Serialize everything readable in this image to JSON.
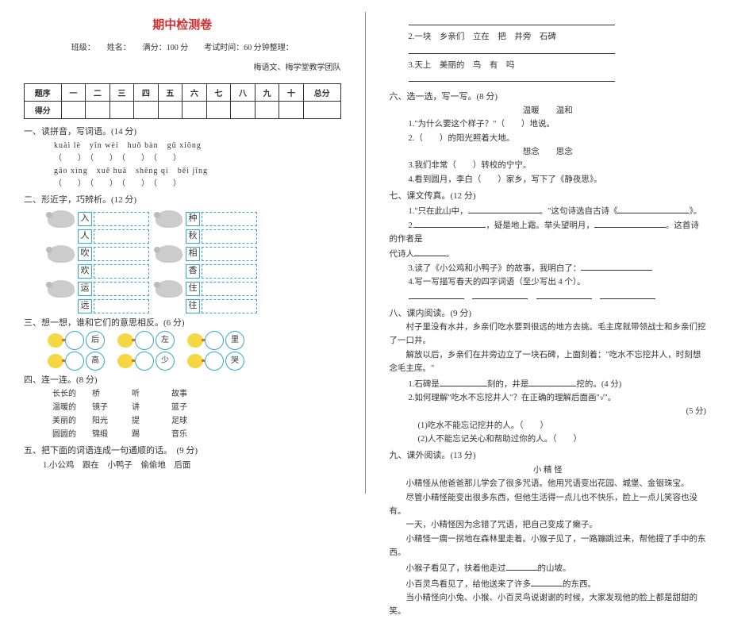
{
  "title": "期中检测卷",
  "header": "班级：　　姓名：　　满分：100 分　　考试时间：60 分钟整理：",
  "credit": "梅语文、梅学堂教学团队",
  "scoreTable": {
    "row1": [
      "题序",
      "一",
      "二",
      "三",
      "四",
      "五",
      "六",
      "七",
      "八",
      "九",
      "十",
      "总分"
    ],
    "row2Label": "得分"
  },
  "s1": {
    "title": "一、读拼音，写词语。(14 分)",
    "pinyin1": "kuài lè　yīn wèi　huǒ bàn　gǔ xiōng",
    "paren1": "（　　）　（　　）　（　　）　（　　）",
    "pinyin2": "gāo xìng　xuě huā　shēng qì　běi jīng",
    "paren2": "（　　）　（　　）　（　　）　（　　）"
  },
  "s2": {
    "title": "二、形近字，巧辨析。(12 分)",
    "pairs": [
      [
        "入",
        "种"
      ],
      [
        "人",
        "秋"
      ],
      [
        "吹",
        "相"
      ],
      [
        "欢",
        "香"
      ],
      [
        "运",
        "住"
      ],
      [
        "远",
        "往"
      ]
    ]
  },
  "s3": {
    "title": "三、想一想，谁和它们的意思相反。(6 分)",
    "row1": [
      "后",
      "左",
      "里"
    ],
    "row2": [
      "高",
      "少",
      "哭"
    ]
  },
  "s4": {
    "title": "四、连一连。(8 分)",
    "left": [
      "长长的",
      "温暖的",
      "美丽的",
      "圆圆的"
    ],
    "mid1": [
      "桥",
      "镜子",
      "阳光",
      "锦缎"
    ],
    "mid2": [
      "听",
      "讲",
      "提",
      "踢"
    ],
    "right": [
      "故事",
      "篮子",
      "足球",
      "音乐"
    ]
  },
  "s5": {
    "title": "五、把下面的词语连成一句通顺的话。　(9 分)",
    "item1": "1.小公鸡　跟在　小鸭子　偷偷地　后面",
    "item2": "2.一块　乡亲们　立在　把　井旁　石碑",
    "item3": "3.天上　美丽的　鸟　有　吗"
  },
  "s6": {
    "title": "六、选一选，写一写。(8 分)",
    "pair1": "温暖　　温和",
    "q1": "1.\"为什么要这个样子？\"（　　）地说。",
    "q2": "2.（　　）的阳光照着大地。",
    "pair2": "想念　　思念",
    "q3": "3.我们非常（　　）转校的宁宁。",
    "q4": "4.看到圆月，李白（　　）家乡，写下了《静夜思》。"
  },
  "s7": {
    "title": "七、课文传真。(12 分)",
    "q1a": "1.\"只在此山中，",
    "q1b": "。\"这句诗选自古诗《",
    "q1c": "》。",
    "q2a": "2.",
    "q2b": "，疑是地上霜。举头望明月，",
    "q2c": "。这首诗的作者是",
    "q2d": "代诗人",
    "q2e": "。",
    "q3": "3.读了《小公鸡和小鸭子》的故事，我明白了：",
    "q4": "4.写一写描写春天的四字词语（至少写出 4 个）。"
  },
  "s8": {
    "title": "八、课内阅读。(9 分)",
    "p1": "村子里没有水井，乡亲们吃水要到很远的地方去挑。毛主席就带领战士和乡亲们挖了一口井。",
    "p2": "解放以后，乡亲们在井旁边立了一块石碑，上面刻着：\"吃水不忘挖井人，时刻想念毛主席。\"",
    "q1a": "1.石碑是",
    "q1b": "刻的，井是",
    "q1c": "挖的。(4 分)",
    "q2": "2.如何理解\"吃水不忘挖井人\"？在正确的理解后面画\"√\"。",
    "q2score": "(5 分)",
    "opt1": "(1)吃水不能忘记挖井的人。（　　）",
    "opt2": "(2)人不能忘记关心和帮助过你的人。（　　）"
  },
  "s9": {
    "title": "九、课外阅读。(13 分)",
    "storyTitle": "小 精 怪",
    "p1": "小精怪从他爸爸那儿学会了很多咒语。他用咒语变出花园、城堡、金银珠宝。",
    "p2": "尽管小精怪能变出很多东西，但他生活得一点儿也不快乐，脸上一点儿笑容也没有。",
    "p3": "一天，小精怪因为念错了咒语，把自己变成了癞子。",
    "p4a": "小精怪一瘸一拐地在森林里走着。小猴子见了，一路蹦跳过来，帮他提了手中的东西。",
    "p4b": "小猴子看见了，扶着他走过",
    "p4c": "的山坡。",
    "p5a": "小百灵鸟看见了，给他送来了许多",
    "p5b": "的东西。",
    "p6": "当小精怪向小兔、小猴、小百灵鸟说谢谢的时候，大家发现他的脸上都是甜甜的笑。"
  }
}
